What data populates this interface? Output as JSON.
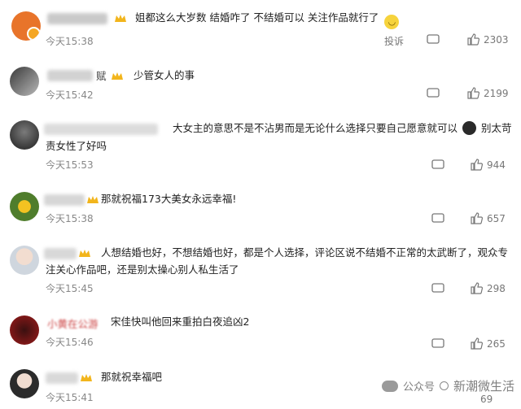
{
  "actions": {
    "report_label": "投诉"
  },
  "comments": [
    {
      "text": "姐都这么大岁数 结婚咋了 不结婚可以 关注作品就行了",
      "time": "今天15:38",
      "likes": "2303"
    },
    {
      "name_tail": "赋",
      "text": "少管女人的事",
      "time": "今天15:42",
      "likes": "2199"
    },
    {
      "text_line1": "大女主的意思不是不沾男而是无论什么选择只要自己愿意就可以",
      "text_after_emoji": "别太苛",
      "text_line2": "责女性了好吗",
      "time": "今天15:53",
      "likes": "944"
    },
    {
      "text": "那就祝福173大美女永远幸福!",
      "time": "今天15:38",
      "likes": "657"
    },
    {
      "text_line1": "人想结婚也好，不想结婚也好，都是个人选择，评论区说不结婚不正常的太武断了，观众专",
      "text_line2": "注关心作品吧，还是别太操心别人私生活了",
      "time": "今天15:45",
      "likes": "298"
    },
    {
      "name": "小黄在公游",
      "text": "宋佳快叫他回来重拍白夜追凶2",
      "time": "今天15:46",
      "likes": "265"
    },
    {
      "text": "那就祝幸福吧",
      "time": "今天15:41",
      "likes": "69"
    }
  ],
  "watermark": {
    "source": "公众号",
    "account": "新潮微生活"
  },
  "colors": {
    "badge_gold": "#f2b51c",
    "text": "#222222",
    "meta": "#888888",
    "avatar_orange": "#e8742a"
  }
}
